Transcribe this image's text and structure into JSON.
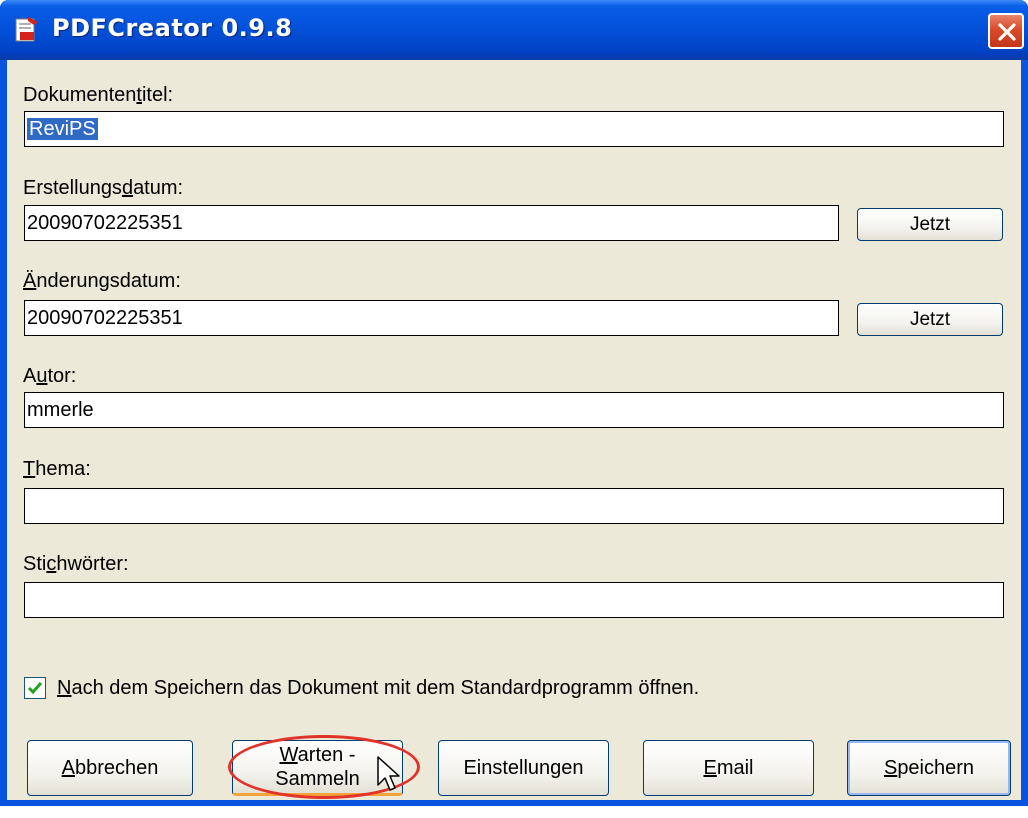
{
  "window": {
    "title": "PDFCreator 0.9.8"
  },
  "fields": {
    "dokumententitel": {
      "label_pre": "Dokumenten",
      "label_key": "t",
      "label_post": "itel:",
      "value": "ReviPS"
    },
    "erstellungsdatum": {
      "label_pre": "Erstellungs",
      "label_key": "d",
      "label_post": "atum:",
      "value": "20090702225351",
      "button": "Jetzt"
    },
    "aenderungsdatum": {
      "label_pre": "",
      "label_key": "Ä",
      "label_post": "nderungsdatum:",
      "value": "20090702225351",
      "button": "Jetzt"
    },
    "autor": {
      "label_pre": "A",
      "label_key": "u",
      "label_post": "tor:",
      "value": "mmerle"
    },
    "thema": {
      "label_pre": "",
      "label_key": "T",
      "label_post": "hema:",
      "value": ""
    },
    "stichwoerter": {
      "label_pre": "Sti",
      "label_key": "c",
      "label_post": "hwörter:",
      "value": ""
    }
  },
  "open_after_save": {
    "checked": true,
    "label_key": "N",
    "label_post": "ach dem Speichern das Dokument mit dem Standardprogramm öffnen."
  },
  "buttons": {
    "abbrechen": {
      "pre": "",
      "key": "A",
      "post": "bbrechen"
    },
    "warten_line1_key": "W",
    "warten_line1_post": "arten -",
    "warten_line2": "Sammeln",
    "einstellungen": "Einstellungen",
    "email": {
      "key": "E",
      "post": "mail"
    },
    "speichern": {
      "key": "S",
      "post": "peichern"
    }
  },
  "colors": {
    "titlebar": "#0350d8",
    "dialog_bg": "#ece9d8",
    "selection": "#316ac5",
    "annotation": "#e0332a"
  }
}
